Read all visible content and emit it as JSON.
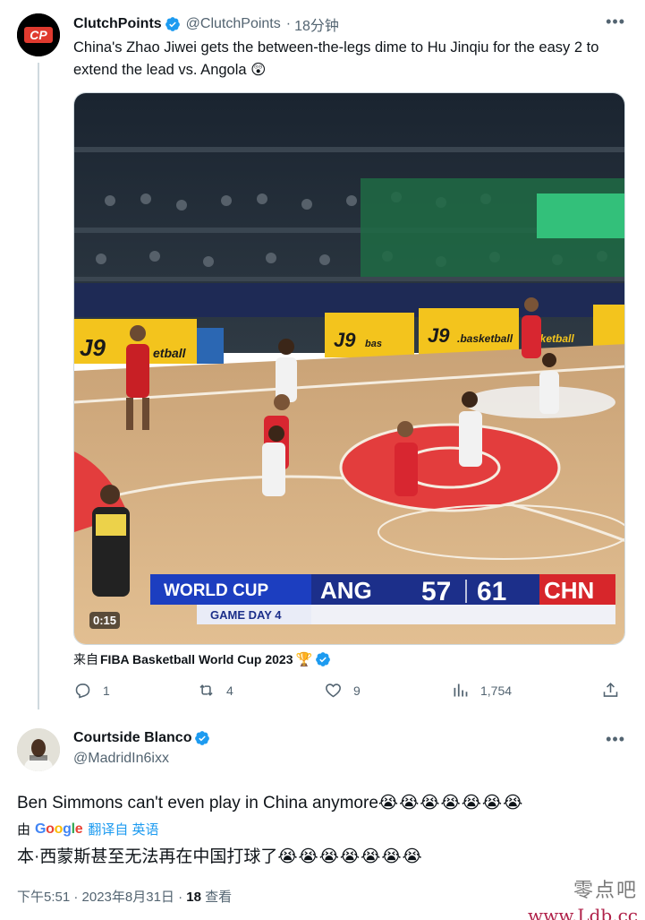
{
  "tweet": {
    "author_name": "ClutchPoints",
    "author_handle": "@ClutchPoints",
    "time_ago": "18分钟",
    "text": "China's Zhao Jiwei gets the between-the-legs dime to Hu Jinqiu for the easy 2 to extend the lead vs. Angola 😲",
    "video_time": "0:15",
    "source_prefix": "来自",
    "source_name": "FIBA Basketball World Cup 2023",
    "source_badge": "🏆",
    "replies": "1",
    "retweets": "4",
    "likes": "9",
    "views": "1,754"
  },
  "scoreboard": {
    "event": "WORLD CUP",
    "subtitle": "GAME DAY 4",
    "team_a": "ANG",
    "score_a": "57",
    "score_b": "61",
    "team_b": "CHN",
    "sponsor": "J9",
    "sponsor_suffix": ".basketball",
    "sponsor_left": "etball",
    "sponsor_center": "bas",
    "sponsor_right": "basketball"
  },
  "reply": {
    "author_name": "Courtside Blanco",
    "author_handle": "@MadridIn6ixx",
    "text": "Ben Simmons can't even play in China anymore",
    "emojis": "😭😭😭😭😭😭😭",
    "translate_prefix": "由",
    "translate_brand": "Google",
    "translate_link": "翻译自 英语",
    "translated_text": "本·西蒙斯甚至无法再在中国打球了",
    "time": "下午5:51 · 2023年8月31日",
    "views_count": "18",
    "views_label": "查看"
  },
  "watermark": {
    "line1": "零点吧",
    "line2": "www.Ldb.cc"
  },
  "colors": {
    "verified_blue": "#1d9bf0",
    "secondary_text": "#536471",
    "court_wood": "#d9b382",
    "china_red": "#d7262b",
    "score_navy": "#1c2f8a"
  },
  "icons": {
    "reply": "reply-icon",
    "retweet": "retweet-icon",
    "like": "heart-icon",
    "views": "views-chart-icon",
    "share": "share-icon",
    "more": "more-icon"
  }
}
